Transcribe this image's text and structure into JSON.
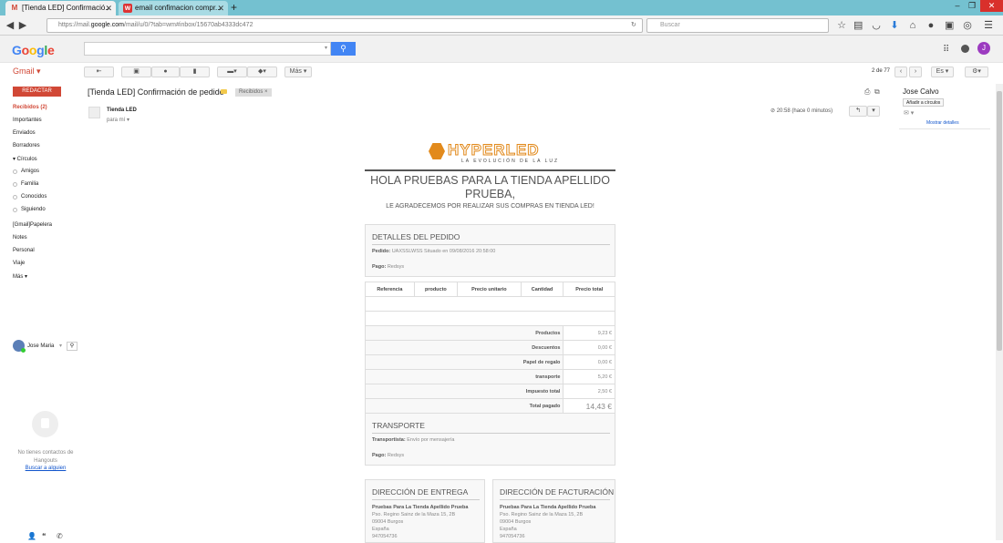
{
  "browser": {
    "tabs": [
      {
        "favicon": "M",
        "title": "[Tienda LED] Confirmació...",
        "active": true
      },
      {
        "favicon": "w",
        "title": "email confimacion compr...",
        "active": false
      }
    ],
    "url_prefix": "https://mail.",
    "url_domain": "google.com",
    "url_suffix": "/mail/u/0/?tab=wm#inbox/15670ab4333dc472",
    "search_placeholder": "Buscar"
  },
  "gmail": {
    "logo": [
      {
        "ch": "G",
        "color": "#4285f4"
      },
      {
        "ch": "o",
        "color": "#ea4335"
      },
      {
        "ch": "o",
        "color": "#fbbc05"
      },
      {
        "ch": "g",
        "color": "#4285f4"
      },
      {
        "ch": "l",
        "color": "#34a853"
      },
      {
        "ch": "e",
        "color": "#ea4335"
      }
    ],
    "avatar_initial": "J",
    "app_label": "Gmail ▾",
    "more_label": "Más ▾",
    "counter": "2 de 77",
    "lang": "Es ▾"
  },
  "nav": {
    "compose": "REDACTAR",
    "items": [
      {
        "label": "Recibidos (2)",
        "selected": true,
        "sub": false
      },
      {
        "label": "Importantes",
        "selected": false,
        "sub": false
      },
      {
        "label": "Enviados",
        "selected": false,
        "sub": false
      },
      {
        "label": "Borradores",
        "selected": false,
        "sub": false
      },
      {
        "label": "▾ Círculos",
        "selected": false,
        "sub": false
      },
      {
        "label": "Amigos",
        "selected": false,
        "sub": true
      },
      {
        "label": "Familia",
        "selected": false,
        "sub": true
      },
      {
        "label": "Conocidos",
        "selected": false,
        "sub": true
      },
      {
        "label": "Siguiendo",
        "selected": false,
        "sub": true
      },
      {
        "label": "[Gmail]Papelera",
        "selected": false,
        "sub": false
      },
      {
        "label": "Notes",
        "selected": false,
        "sub": false
      },
      {
        "label": "Personal",
        "selected": false,
        "sub": false
      },
      {
        "label": "Viaje",
        "selected": false,
        "sub": false
      },
      {
        "label": "Más ▾",
        "selected": false,
        "sub": false
      }
    ],
    "hangout_user": "Jose Maria",
    "no_contacts": "No tienes contactos de Hangouts",
    "find_someone": "Buscar a alguien"
  },
  "message": {
    "subject": "[Tienda LED] Confirmación de pedido",
    "label": "Recibidos ×",
    "sender": "Tienda LED",
    "to": "para mí ▾",
    "time": "20:58 (hace 0 minutos)",
    "contact_name": "Jose Calvo",
    "add_circles": "Añadir a círculos",
    "show_details": "Mostrar detalles"
  },
  "email": {
    "brand_a": "HYPER",
    "brand_b": "LED",
    "tagline": "LA EVOLUCIÓN DE LA LUZ",
    "greeting": "HOLA PRUEBAS PARA LA TIENDA APELLIDO PRUEBA,",
    "thanks": "LE AGRADECEMOS POR REALIZAR SUS COMPRAS EN TIENDA LED!",
    "details_title": "DETALLES DEL PEDIDO",
    "order_label": "Pedido:",
    "order_value": "UAXSSLWSS Situado en 09/08/2016 20:58:00",
    "payment_label": "Pago:",
    "payment_value": "Redsys",
    "table_headers": [
      "Referencia",
      "producto",
      "Precio unitario",
      "Cantidad",
      "Precio total"
    ],
    "totals": [
      {
        "label": "Productos",
        "value": "9,23 €"
      },
      {
        "label": "Descuentos",
        "value": "0,00 €"
      },
      {
        "label": "Papel de regalo",
        "value": "0,00 €"
      },
      {
        "label": "transporte",
        "value": "5,20 €"
      },
      {
        "label": "Impuesto total",
        "value": "2,50 €"
      },
      {
        "label": "Total pagado",
        "value": "14,43 €"
      }
    ],
    "transport_title": "TRANSPORTE",
    "carrier_label": "Transportista:",
    "carrier_value": "Envío por mensajería",
    "payment2_label": "Pago:",
    "payment2_value": "Redsys",
    "delivery_title": "DIRECCIÓN DE ENTREGA",
    "billing_title": "DIRECCIÓN DE FACTURACIÓN",
    "address": {
      "name": "Pruebas Para La Tienda Apellido Prueba",
      "street": "Pso. Regino Sainz de la Maza 15, 2B",
      "city": "09004 Burgos",
      "country": "España",
      "phone": "947054736"
    }
  },
  "colors": {
    "gmail_red": "#d14836",
    "link": "#1155cc",
    "brand_orange": "#e28a1c"
  }
}
